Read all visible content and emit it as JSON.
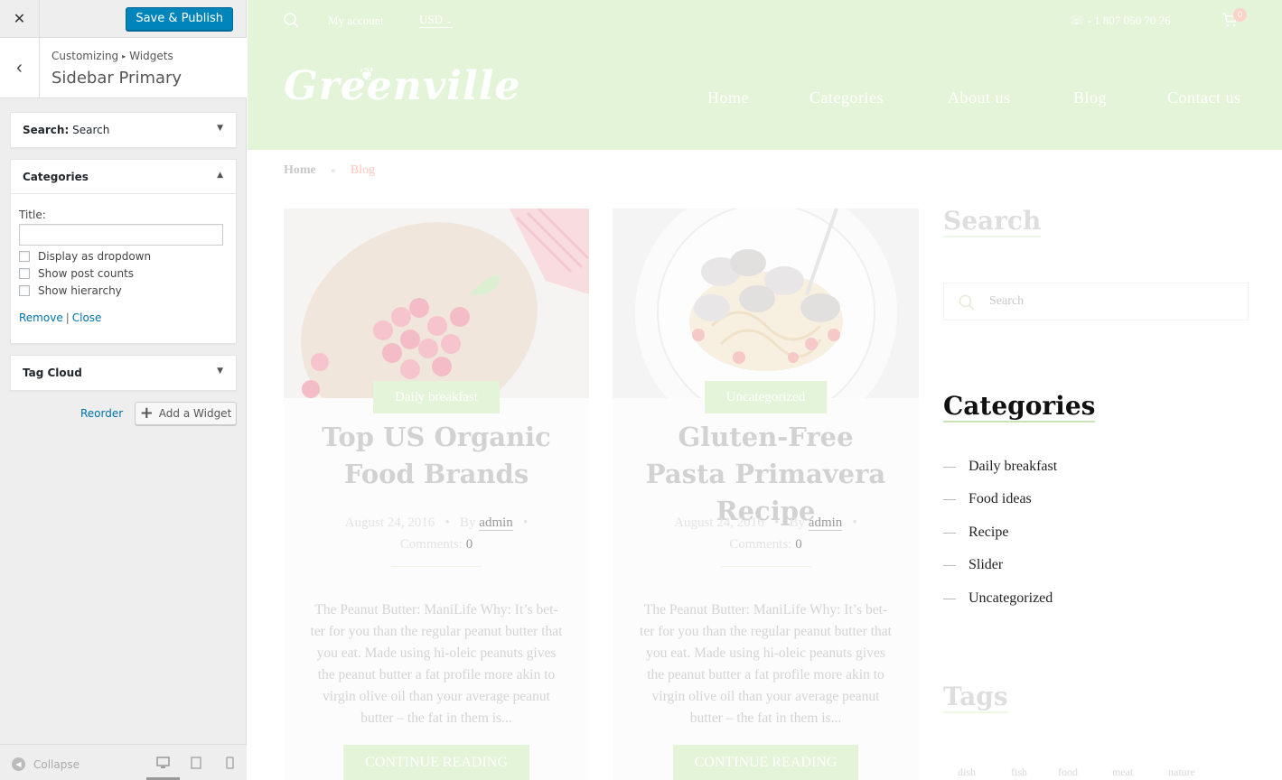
{
  "customizer": {
    "close_icon": "close-icon",
    "publish_label": "Save & Publish",
    "breadcrumb": {
      "part1": "Customizing",
      "sep": "▸",
      "part2": "Widgets"
    },
    "section_title": "Sidebar Primary",
    "widgets": {
      "search": {
        "label": "Search:",
        "subtitle": "Search"
      },
      "categories": {
        "label": "Categories",
        "title_label": "Title:",
        "title_value": "",
        "options": [
          "Display as dropdown",
          "Show post counts",
          "Show hierarchy"
        ],
        "remove": "Remove",
        "pipe": "|",
        "close": "Close"
      },
      "tag_cloud": {
        "label": "Tag Cloud"
      }
    },
    "reorder_label": "Reorder",
    "add_widget_label": "Add a Widget",
    "collapse_label": "Collapse"
  },
  "site": {
    "topbar": {
      "account": "My account",
      "currency": "USD",
      "phone": "- 1 807 050 70 26",
      "cart_count": "0"
    },
    "logo": "Greenville",
    "nav": [
      "Home",
      "Categories",
      "About us",
      "Blog",
      "Contact us"
    ],
    "breadcrumbs": {
      "home": "Home",
      "current": "Blog"
    },
    "posts": [
      {
        "category": "Daily breakfast",
        "title": "Top US Organic Food Brands",
        "date": "August 24, 2016",
        "by": "By",
        "author": "admin",
        "comments_label": "Comments:",
        "comments": "0",
        "excerpt": "The Peanut Butter: ManiLife Why: It’s bet-ter for you than the regular peanut butter that you eat. Made using hi-oleic peanuts gives the peanut butter a fat profile more akin to virgin olive oil than your average peanut butter – the fat in them is...",
        "button": "CONTINUE READING"
      },
      {
        "category": "Uncategorized",
        "title": "Gluten-Free Pasta Primavera Recipe",
        "date": "August 24, 2016",
        "by": "By",
        "author": "admin",
        "comments_label": "Comments:",
        "comments": "0",
        "excerpt": "The Peanut Butter: ManiLife Why: It’s bet-ter for you than the regular peanut butter that you eat. Made using hi-oleic peanuts gives the peanut butter a fat profile more akin to virgin olive oil than your average peanut butter – the fat in them is...",
        "button": "CONTINUE READING"
      }
    ],
    "sidebar": {
      "search_title": "Search",
      "search_placeholder": "Search",
      "categories_title": "Categories",
      "categories": [
        "Daily breakfast",
        "Food ideas",
        "Recipe",
        "Slider",
        "Uncategorized"
      ],
      "tags_title": "Tags",
      "tags": [
        "dish",
        "fish",
        "food",
        "meat",
        "nature"
      ]
    }
  },
  "colors": {
    "accent": "#0085ba",
    "link": "#0073aa",
    "site_header_bg": "#e4f4d8",
    "breadcrumb_active": "#ffc4b8"
  }
}
